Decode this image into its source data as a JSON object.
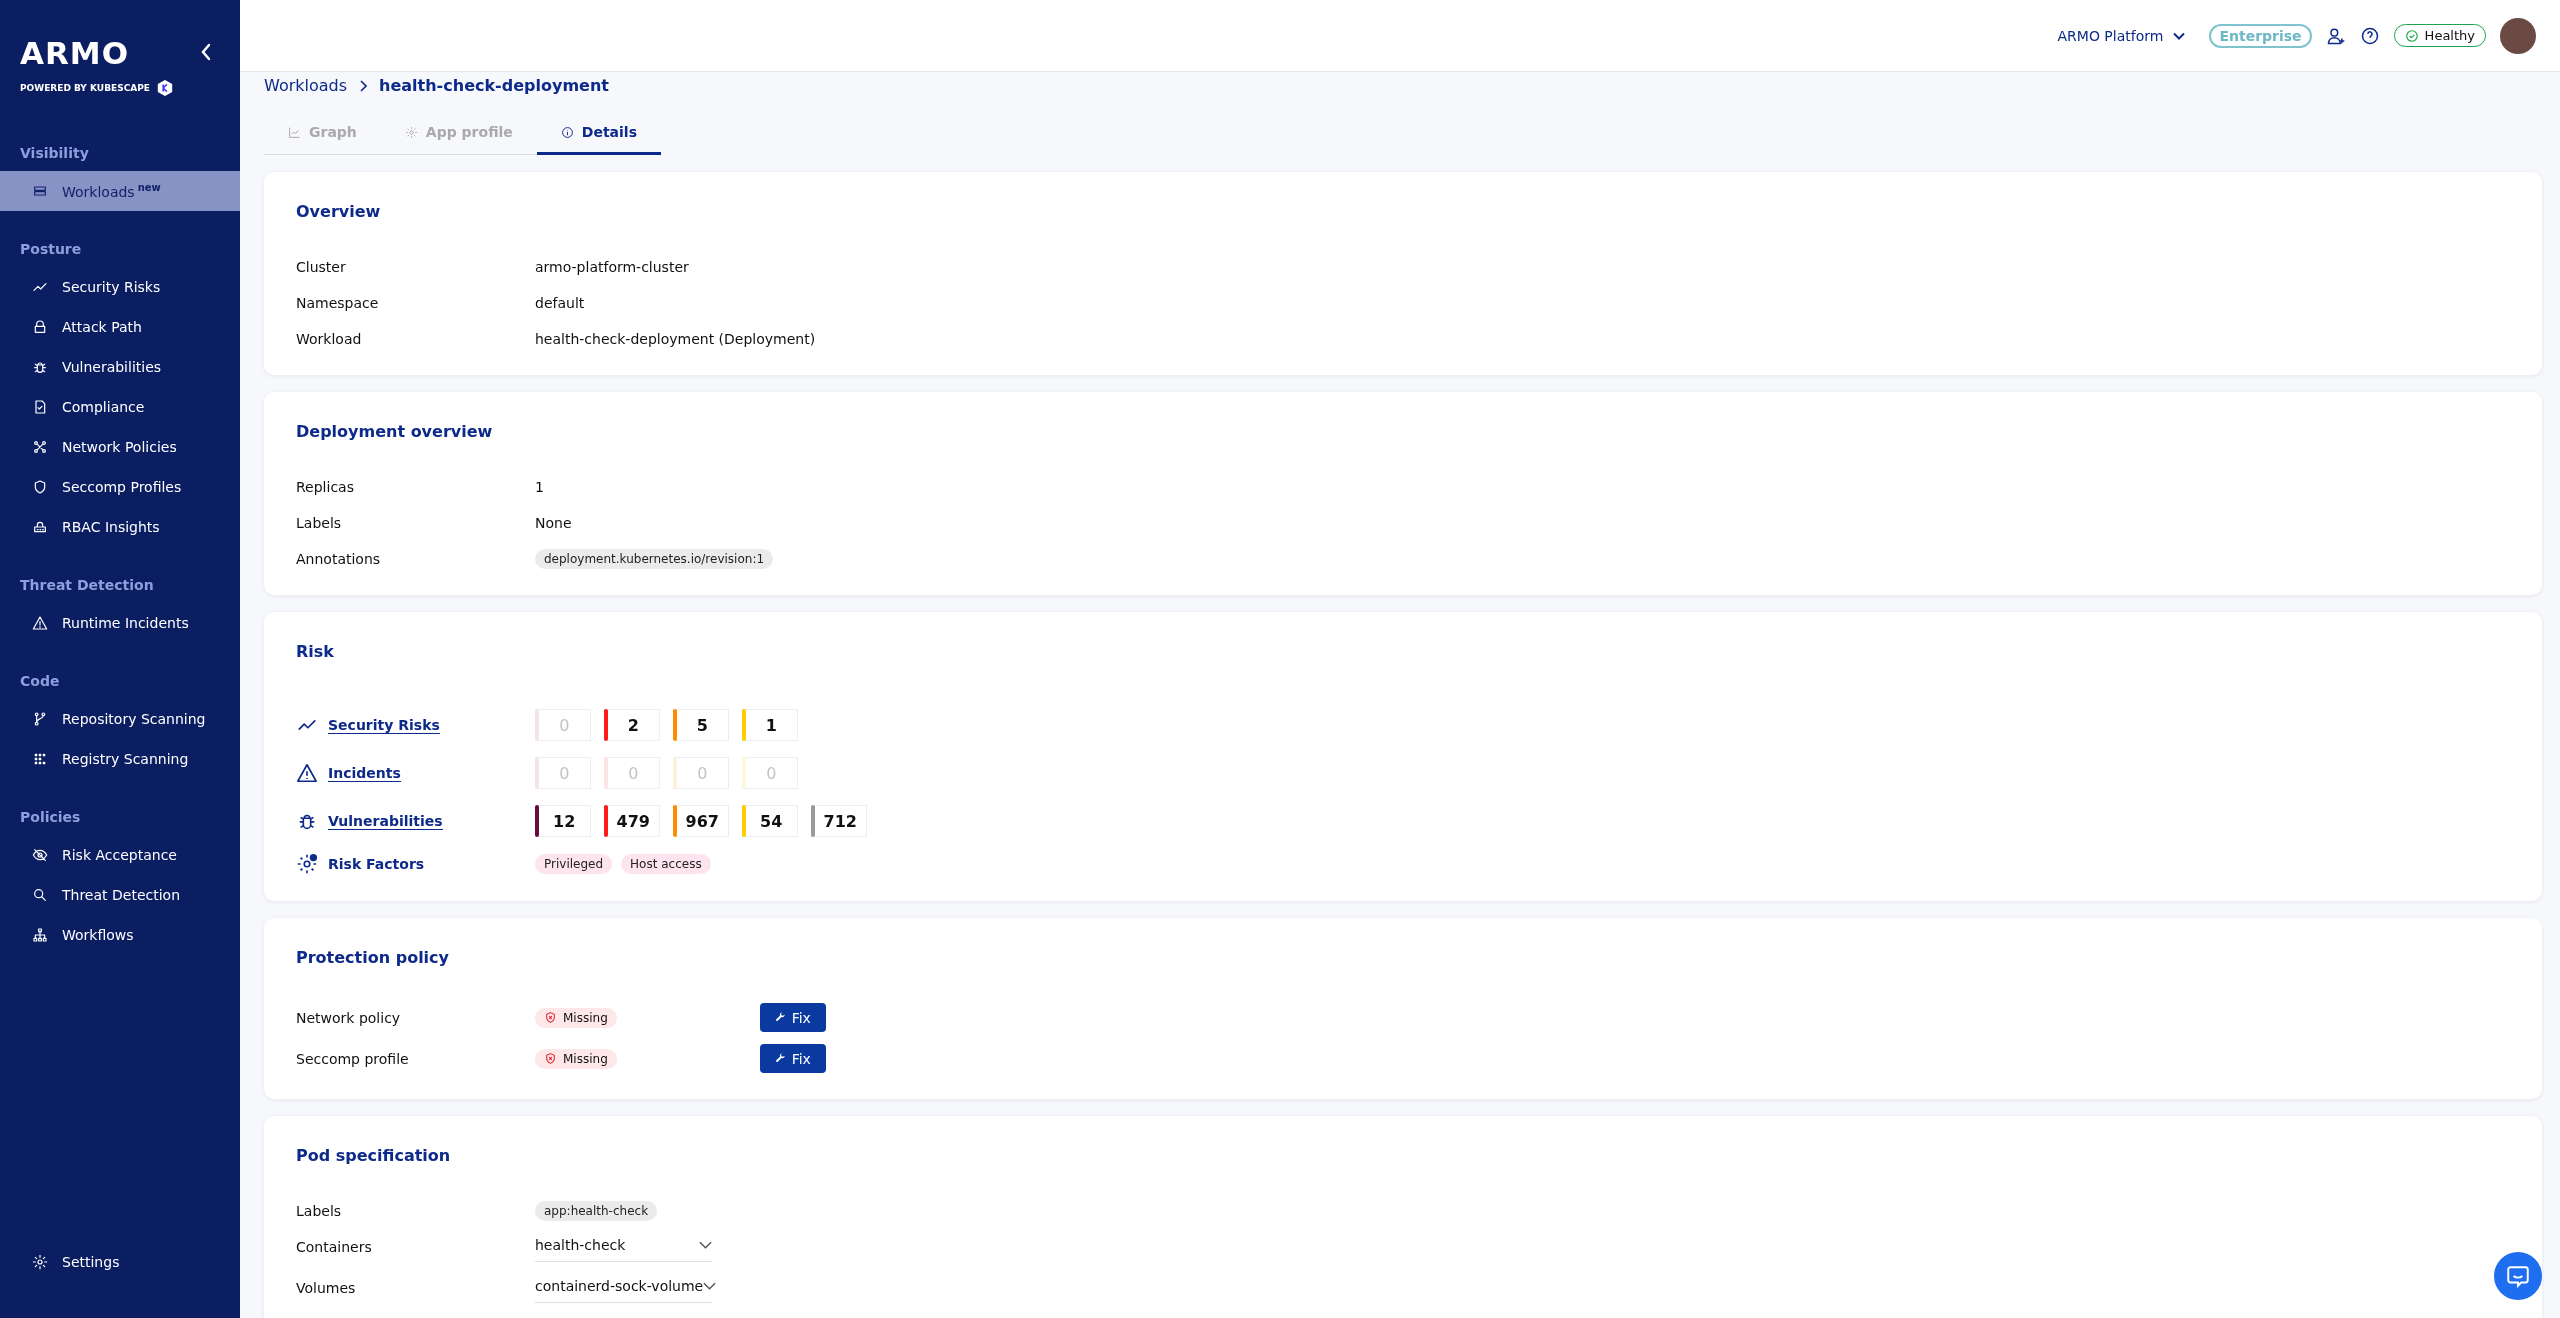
{
  "sidebar": {
    "logo": "ARMO",
    "powered_by": "POWERED BY KUBESCAPE",
    "sections": [
      {
        "title": "Visibility",
        "items": [
          {
            "label": "Workloads",
            "badge": "new",
            "selected": true
          }
        ]
      },
      {
        "title": "Posture",
        "items": [
          {
            "label": "Security Risks",
            "selected": false
          },
          {
            "label": "Attack Path",
            "selected": false
          },
          {
            "label": "Vulnerabilities",
            "selected": false
          },
          {
            "label": "Compliance",
            "selected": false
          },
          {
            "label": "Network Policies",
            "selected": false
          },
          {
            "label": "Seccomp Profiles",
            "selected": false
          },
          {
            "label": "RBAC Insights",
            "selected": false
          }
        ]
      },
      {
        "title": "Threat Detection",
        "items": [
          {
            "label": "Runtime Incidents",
            "selected": false
          }
        ]
      },
      {
        "title": "Code",
        "items": [
          {
            "label": "Repository Scanning",
            "selected": false
          },
          {
            "label": "Registry Scanning",
            "selected": false
          }
        ]
      },
      {
        "title": "Policies",
        "items": [
          {
            "label": "Risk Acceptance",
            "selected": false
          },
          {
            "label": "Threat Detection",
            "selected": false
          },
          {
            "label": "Workflows",
            "selected": false
          }
        ]
      }
    ],
    "settings": "Settings"
  },
  "header": {
    "platform": "ARMO Platform",
    "plan": "Enterprise",
    "status": "Healthy"
  },
  "breadcrumb": {
    "parent": "Workloads",
    "current": "health-check-deployment"
  },
  "tabs": [
    {
      "label": "Graph",
      "selected": false
    },
    {
      "label": "App profile",
      "selected": false
    },
    {
      "label": "Details",
      "selected": true
    }
  ],
  "cards": [
    {
      "title": "Overview",
      "rows": [
        {
          "kind": "text",
          "label": "Cluster",
          "value": "armo-platform-cluster"
        },
        {
          "kind": "text",
          "label": "Namespace",
          "value": "default"
        },
        {
          "kind": "text",
          "label": "Workload",
          "value": "health-check-deployment (Deployment)"
        }
      ]
    },
    {
      "title": "Deployment overview",
      "rows": [
        {
          "kind": "text",
          "label": "Replicas",
          "value": "1"
        },
        {
          "kind": "text",
          "label": "Labels",
          "value": "None"
        },
        {
          "kind": "tags",
          "label": "Annotations",
          "tags": [
            "deployment.kubernetes.io/revision:1"
          ]
        }
      ]
    },
    {
      "title": "Risk",
      "rows": [
        {
          "kind": "counts",
          "label": "Security Risks",
          "link": true,
          "counts": [
            {
              "value": "0",
              "color": "#f3e4eb",
              "muted": true
            },
            {
              "value": "2",
              "color": "#ff1a1a",
              "muted": false
            },
            {
              "value": "5",
              "color": "#ff8c00",
              "muted": false
            },
            {
              "value": "1",
              "color": "#ffcc00",
              "muted": false
            }
          ]
        },
        {
          "kind": "counts",
          "label": "Incidents",
          "link": true,
          "counts": [
            {
              "value": "0",
              "color": "#f3e4eb",
              "muted": true
            },
            {
              "value": "0",
              "color": "#ffe4e4",
              "muted": true
            },
            {
              "value": "0",
              "color": "#fff0e0",
              "muted": true
            },
            {
              "value": "0",
              "color": "#fff7de",
              "muted": true
            }
          ]
        },
        {
          "kind": "counts",
          "label": "Vulnerabilities",
          "link": true,
          "counts": [
            {
              "value": "12",
              "color": "#6b0a3e",
              "muted": false
            },
            {
              "value": "479",
              "color": "#ff1a1a",
              "muted": false
            },
            {
              "value": "967",
              "color": "#ff8c00",
              "muted": false
            },
            {
              "value": "54",
              "color": "#ffcc00",
              "muted": false
            },
            {
              "value": "712",
              "color": "#9a9a9a",
              "muted": false
            }
          ]
        },
        {
          "kind": "tags",
          "label": "Risk Factors",
          "link": false,
          "tags": [
            "Privileged",
            "Host access"
          ]
        }
      ]
    },
    {
      "title": "Protection policy",
      "rows": [
        {
          "kind": "status",
          "label": "Network policy",
          "status": "Missing",
          "action": "Fix"
        },
        {
          "kind": "status",
          "label": "Seccomp profile",
          "status": "Missing",
          "action": "Fix"
        }
      ]
    },
    {
      "title": "Pod specification",
      "rows": [
        {
          "kind": "tags",
          "label": "Labels",
          "tags": [
            "app:health-check"
          ]
        },
        {
          "kind": "select",
          "label": "Containers",
          "value": "health-check"
        },
        {
          "kind": "select",
          "label": "Volumes",
          "value": "containerd-sock-volume"
        }
      ]
    }
  ]
}
